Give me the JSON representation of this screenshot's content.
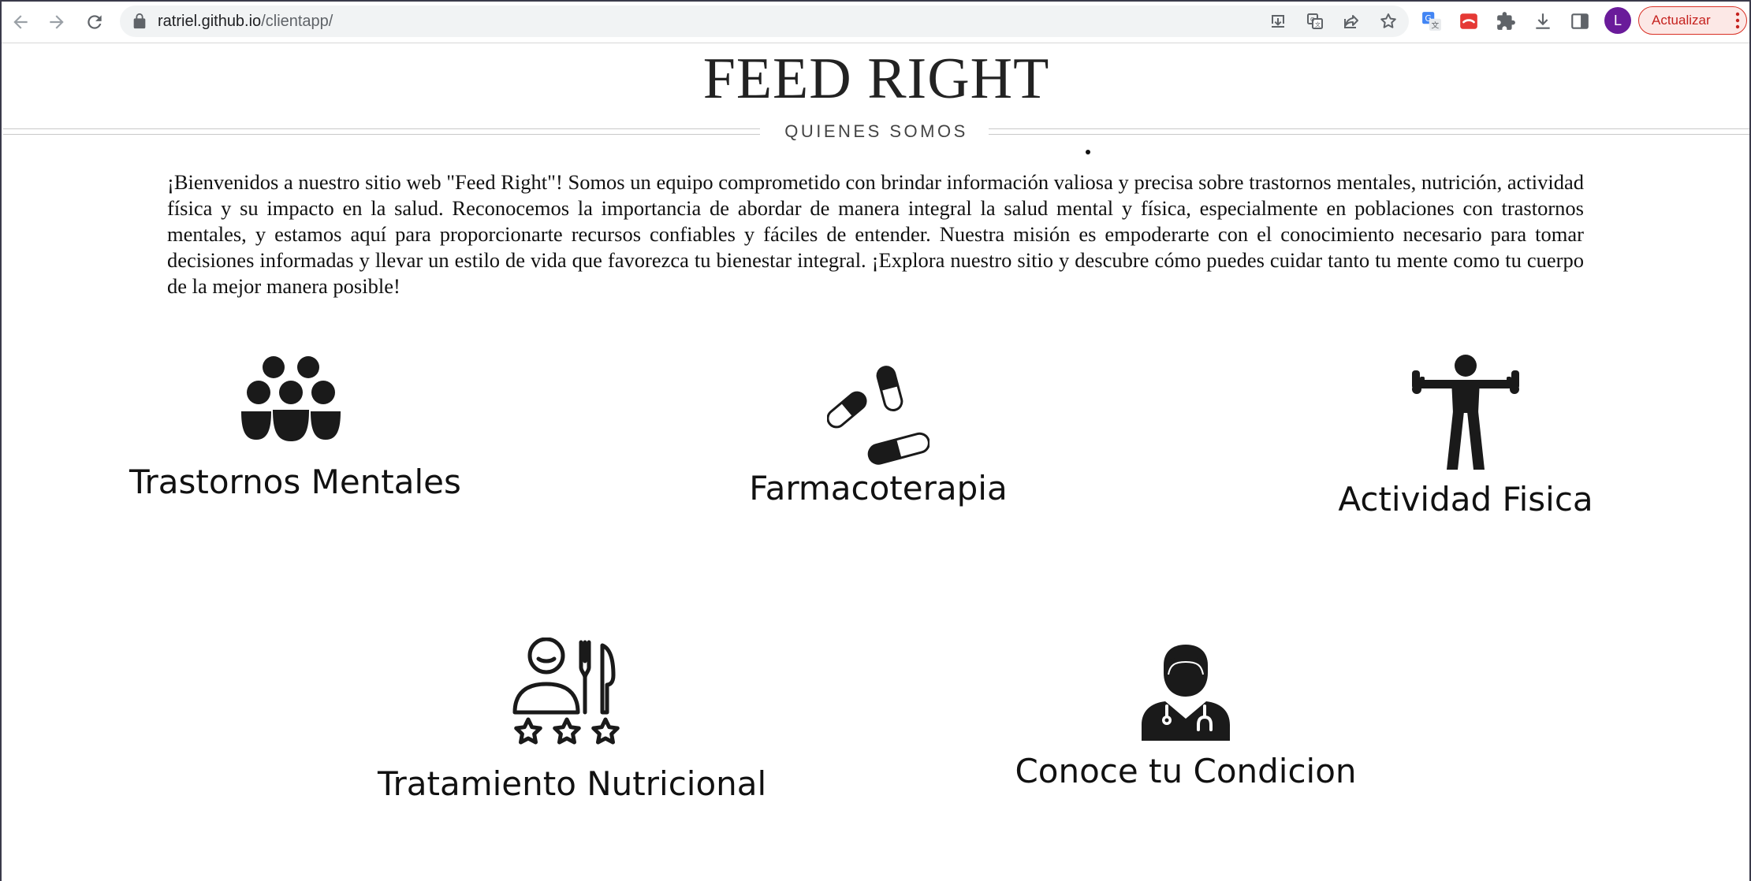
{
  "browser": {
    "url_host": "ratriel.github.io",
    "url_path": "/clientapp/",
    "profile_initial": "L",
    "update_label": "Actualizar"
  },
  "site": {
    "title": "FEED RIGHT",
    "section_label": "QUIENES SOMOS",
    "intro": "¡Bienvenidos a nuestro sitio web \"Feed Right\"! Somos un equipo comprometido con brindar información valiosa y precisa sobre trastornos mentales, nutrición, actividad física y su impacto en la salud. Reconocemos la importancia de abordar de manera integral la salud mental y física, especialmente en poblaciones con trastornos mentales, y estamos aquí para proporcionarte recursos confiables y fáciles de entender. Nuestra misión es empoderarte con el conocimiento necesario para tomar decisiones informadas y llevar un estilo de vida que favorezca tu bienestar integral. ¡Explora nuestro sitio y descubre cómo puedes cuidar tanto tu mente como tu cuerpo de la mejor manera posible!"
  },
  "cards": [
    {
      "label": "Trastornos Mentales",
      "icon": "group-of-people-icon"
    },
    {
      "label": "Farmacoterapia",
      "icon": "pills-icon"
    },
    {
      "label": "Actividad Fisica",
      "icon": "person-lifting-dumbbells-icon"
    },
    {
      "label": "Tratamiento Nutricional",
      "icon": "diner-with-cutlery-and-stars-icon"
    },
    {
      "label": "Conoce tu Condicion",
      "icon": "doctor-with-stethoscope-icon"
    }
  ],
  "colors": {
    "update_border": "#d93025",
    "update_background": "#fce8e6",
    "avatar": "#6a1b9a",
    "icon_fill": "#1a1a1a"
  }
}
